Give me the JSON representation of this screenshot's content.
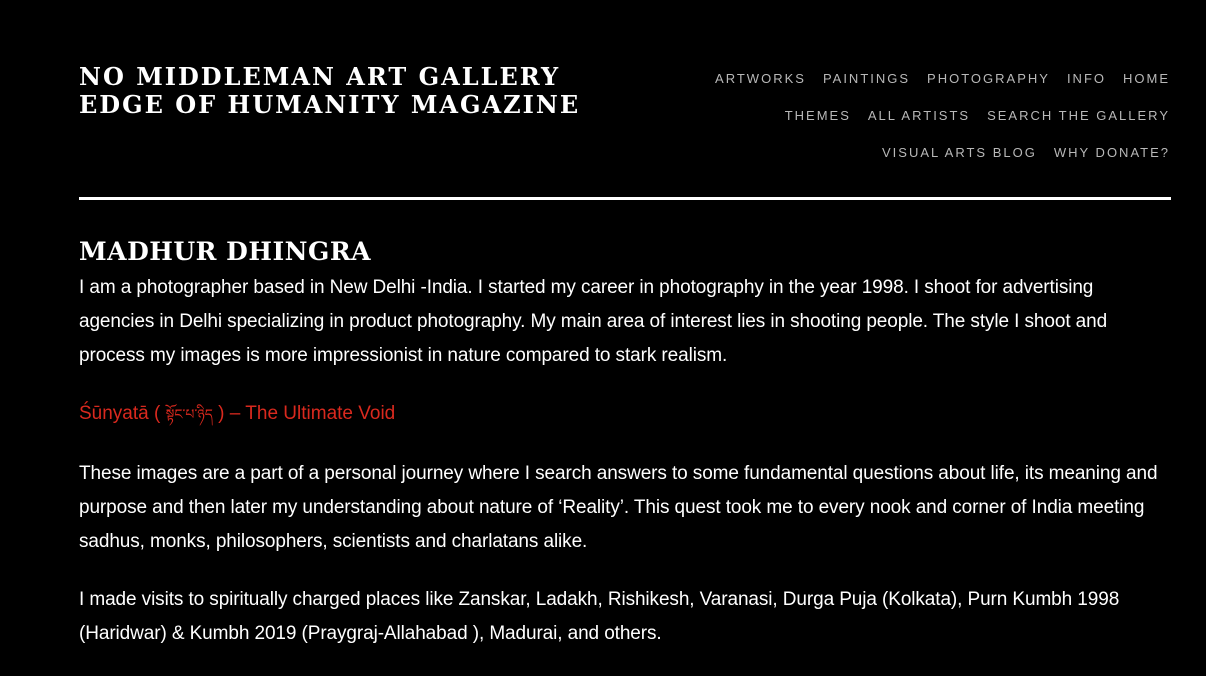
{
  "header": {
    "title_line1": "NO MIDDLEMAN ART GALLERY",
    "title_line2": "EDGE OF HUMANITY MAGAZINE"
  },
  "nav": {
    "row1": [
      "ARTWORKS",
      "PAINTINGS",
      "PHOTOGRAPHY",
      "INFO",
      "HOME"
    ],
    "row2": [
      "THEMES",
      "ALL ARTISTS",
      "SEARCH THE GALLERY"
    ],
    "row3": [
      "VISUAL ARTS BLOG",
      "WHY DONATE?"
    ]
  },
  "main": {
    "artist_name": "MADHUR DHINGRA",
    "intro": "I am a photographer based in New Delhi -India. I started my career in photography in the year 1998.  I shoot for advertising agencies in Delhi specializing in product photography. My main area of interest lies in shooting people. The style I shoot and process my images is more impressionist in nature compared to stark realism.",
    "series_link_prefix": "Śūnyatā ( ",
    "series_link_tibetan": "སྟོང་པ་ཉིད",
    "series_link_suffix": " ) – The Ultimate Void",
    "para2": "These images are a part of a personal journey where I search answers to some fundamental questions about life, its meaning and purpose and then later my understanding about nature of ‘Reality’. This quest took me to every nook and corner of India meeting sadhus, monks, philosophers, scientists and charlatans alike.",
    "para3": "I made visits to spiritually charged places like Zanskar, Ladakh, Rishikesh, Varanasi, Durga Puja (Kolkata), Purn Kumbh 1998 (Haridwar) & Kumbh 2019 (Praygraj-Allahabad ), Madurai, and others."
  },
  "colors": {
    "background": "#000000",
    "text": "#ffffff",
    "nav_text": "#b8b8b8",
    "link_red": "#d9291e"
  }
}
